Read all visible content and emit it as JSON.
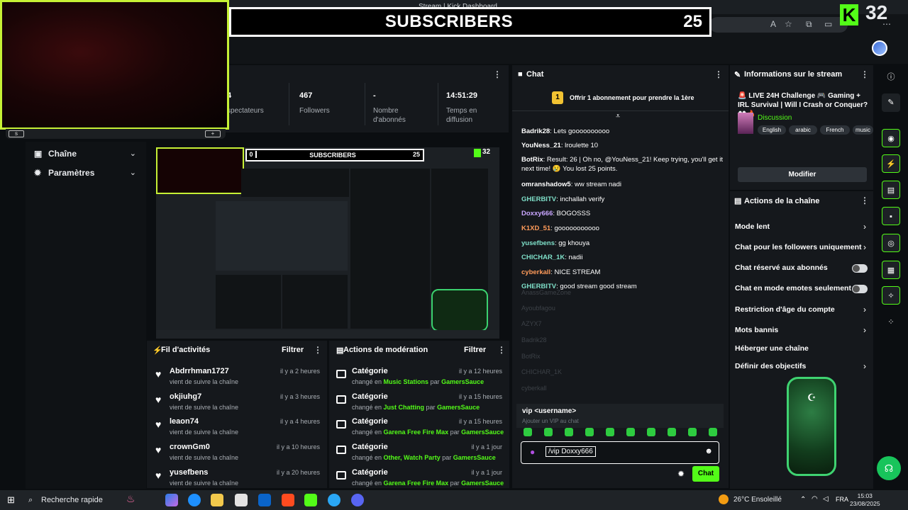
{
  "browser": {
    "tab_title": "Stream | Kick Dashboard",
    "kick_logo": "K",
    "top_count": "32"
  },
  "overlay": {
    "sub_left": "0",
    "sub_title": "SUBSCRIBERS",
    "sub_right": "25"
  },
  "sidebar": {
    "items": [
      {
        "label": "Chaîne",
        "icon": "tv-icon"
      },
      {
        "label": "Paramètres",
        "icon": "gear-icon"
      }
    ]
  },
  "stats": [
    {
      "value": "4",
      "label": "spectateurs"
    },
    {
      "value": "467",
      "label": "Followers"
    },
    {
      "value": "-",
      "label": "Nombre d'abonnés"
    },
    {
      "value": "14:51:29",
      "label": "Temps en diffusion"
    }
  ],
  "activity": {
    "title": "Fil d'activités",
    "filter": "Filtrer",
    "items": [
      {
        "name": "Abdrrhman1727",
        "sub": "vient de suivre la chaîne",
        "time": "il y a 2 heures"
      },
      {
        "name": "okjiuhg7",
        "sub": "vient de suivre la chaîne",
        "time": "il y a 3 heures"
      },
      {
        "name": "leaon74",
        "sub": "vient de suivre la chaîne",
        "time": "il y a 4 heures"
      },
      {
        "name": "crownGm0",
        "sub": "vient de suivre la chaîne",
        "time": "il y a 10 heures"
      },
      {
        "name": "yusefbens",
        "sub": "vient de suivre la chaîne",
        "time": "il y a 20 heures"
      }
    ]
  },
  "moderation": {
    "title": "Actions de modération",
    "filter": "Filtrer",
    "items": [
      {
        "name": "Catégorie",
        "pre": "changé en",
        "cat": "Music Stations",
        "par": "par",
        "user": "GamersSauce",
        "time": "il y a 12 heures"
      },
      {
        "name": "Catégorie",
        "pre": "changé en",
        "cat": "Just Chatting",
        "par": "par",
        "user": "GamersSauce",
        "time": "il y a 15 heures"
      },
      {
        "name": "Catégorie",
        "pre": "changé en",
        "cat": "Garena Free Fire Max",
        "par": "par",
        "user": "GamersSauce",
        "time": "il y a 15 heures"
      },
      {
        "name": "Catégorie",
        "pre": "changé en",
        "cat": "Other, Watch Party",
        "par": "par",
        "user": "GamersSauce",
        "time": "il y a 1 jour"
      },
      {
        "name": "Catégorie",
        "pre": "changé en",
        "cat": "Garena Free Fire Max",
        "par": "par",
        "user": "GamersSauce",
        "time": "il y a 1 jour"
      }
    ]
  },
  "chat": {
    "title": "Chat",
    "promo": "Offrir 1 abonnement pour prendre la 1ère",
    "messages": [
      {
        "user": "Badrik28",
        "color": "#ffffff",
        "text": ": Lets goooooooooo"
      },
      {
        "user": "YouNess_21",
        "color": "#ffffff",
        "text": ": lroulette 10"
      },
      {
        "user": "BotRix",
        "color": "#ffffff",
        "text": ": Result: 26 | Oh no, @YouNess_21! Keep trying, you'll get it next time! 😢 You lost 25 points."
      },
      {
        "user": "omranshadow5",
        "color": "#ffffff",
        "text": ": ww stream nadi"
      },
      {
        "user": "GHERBITV",
        "color": "#7fe0c9",
        "text": ": inchallah verify"
      },
      {
        "user": "Doxxy666",
        "color": "#c9a6ff",
        "text": ": BOGOSSS"
      },
      {
        "user": "K1XD_51",
        "color": "#ff9b5a",
        "text": ": gooooooooooo"
      },
      {
        "user": "yusefbens",
        "color": "#7fe0c9",
        "text": ": gg khouya"
      },
      {
        "user": "CHICHAR_1K",
        "color": "#7fe0c9",
        "text": ": nadii"
      },
      {
        "user": "cyberkall",
        "color": "#ff9b5a",
        "text": ": NICE STREAM"
      },
      {
        "user": "GHERBITV",
        "color": "#7fe0c9",
        "text": ": good stream good stream"
      }
    ],
    "ghost_names": [
      "AnassGameZone",
      "Ayoubfagou",
      "AZYX7",
      "Badrik28",
      "BotRix",
      "CHICHAR_1K",
      "cyberkall"
    ],
    "suggestion_cmd": "vip <username>",
    "suggestion_desc": "Ajouter un VIP au chat",
    "input_value": "/vip Doxxy666",
    "send_label": "Chat"
  },
  "info": {
    "title": "Informations sur le stream",
    "stream_title": "🚨 LIVE 24H Challenge 🎮 Gaming + IRL Survival | Will I Crash or Conquer? 👀🔥",
    "category": "Discussion",
    "tags": [
      "English",
      "arabic",
      "French",
      "music"
    ],
    "edit_label": "Modifier"
  },
  "channel_actions": {
    "title": "Actions de la chaîne",
    "rows": [
      {
        "label": "Mode lent",
        "control": "chevron"
      },
      {
        "label": "Chat pour les followers uniquement",
        "control": "chevron"
      },
      {
        "label": "Chat réservé aux abonnés",
        "control": "toggle"
      },
      {
        "label": "Chat en mode emotes seulement",
        "control": "toggle"
      },
      {
        "label": "Restriction d'âge du compte",
        "control": "chevron"
      },
      {
        "label": "Mots bannis",
        "control": "chevron"
      },
      {
        "label": "Héberger une chaîne",
        "control": "none"
      },
      {
        "label": "Définir des objectifs",
        "control": "chevron"
      }
    ]
  },
  "taskbar": {
    "search": "Recherche rapide",
    "weather": "26°C Ensoleillé",
    "lang": "FRA",
    "time": "15:03",
    "date": "23/08/2025"
  },
  "colors": {
    "accent": "#53fc18",
    "webcam_border": "#c6f135"
  }
}
